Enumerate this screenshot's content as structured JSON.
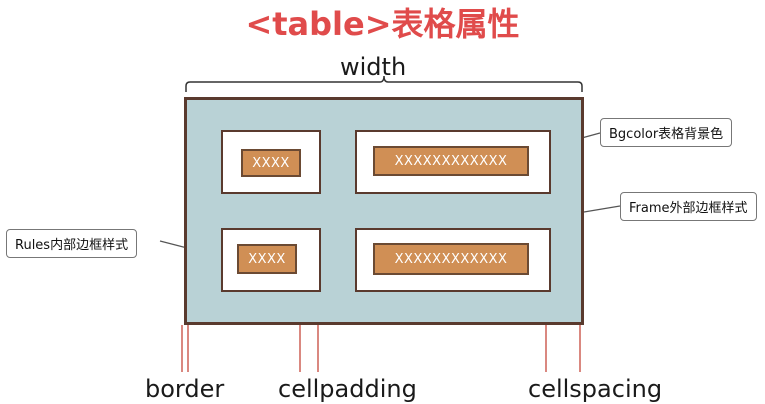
{
  "title": "<table>表格属性",
  "labels": {
    "width": "width",
    "border": "border",
    "cellpadding": "cellpadding",
    "cellspacing": "cellspacing"
  },
  "cells": {
    "top_left": "XXXX",
    "top_right": "XXXXXXXXXXXX",
    "bottom_left": "XXXX",
    "bottom_right": "XXXXXXXXXXXX"
  },
  "callouts": {
    "bgcolor": "Bgcolor表格背景色",
    "frame": "Frame外部边框样式",
    "rules": "Rules内部边框样式"
  },
  "colors": {
    "title": "#e04b4b",
    "table_background": "#b9d2d6",
    "border": "#5a3a2e",
    "content": "#d08f55",
    "guide_lines": "#c0392b"
  }
}
